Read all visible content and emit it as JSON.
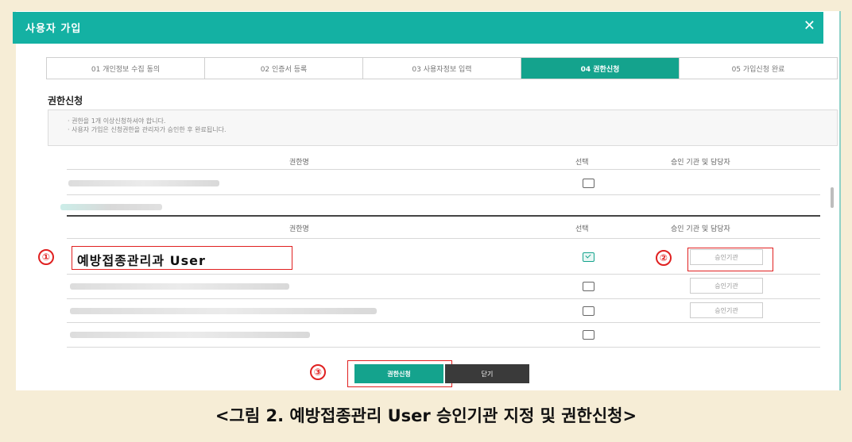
{
  "modal": {
    "title": "사용자 가입",
    "close_icon": "close-icon",
    "header_color": "#14b1a3"
  },
  "steps": [
    {
      "label": "01 개인정보 수집 동의",
      "active": false
    },
    {
      "label": "02 인증서 등록",
      "active": false
    },
    {
      "label": "03 사용자정보 입력",
      "active": false
    },
    {
      "label": "04 권한신청",
      "active": true
    },
    {
      "label": "05 가입신청 완료",
      "active": false
    }
  ],
  "section": {
    "title": "권한신청",
    "notice_lines": [
      "· 권한을 1개 이상신청하셔야 합니다.",
      "· 사용자 가입은 신청권한을 관리자가 승인한 후 완료됩니다."
    ]
  },
  "table_headers": {
    "name": "권한명",
    "select": "선택",
    "approver": "승인 기관 및 담당자"
  },
  "table2_rows": [
    {
      "name": "예방접종관리과 User",
      "checked": true,
      "approve_button": "승인기관"
    },
    {
      "checked": false,
      "approve_button": "승인기관"
    },
    {
      "checked": false,
      "approve_button": "승인기관"
    },
    {
      "checked": false
    }
  ],
  "callouts": [
    "①",
    "②",
    "③"
  ],
  "buttons": {
    "apply": "권한신청",
    "close": "닫기"
  },
  "caption": "<그림 2. 예방접종관리 User 승인기관 지정 및 권한신청>",
  "colors": {
    "accent": "#14a38d",
    "highlight": "#e02020",
    "background": "#f6edd6"
  }
}
